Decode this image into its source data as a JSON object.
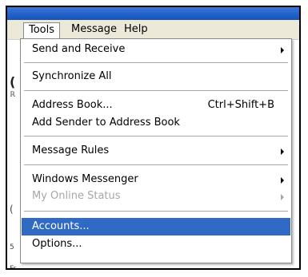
{
  "menubar": {
    "items": [
      {
        "label": "Tools"
      },
      {
        "label": "Message"
      },
      {
        "label": "Help"
      }
    ]
  },
  "background_glyphs": {
    "g1": "(",
    "g2": "ℝ",
    "g3": "(",
    "g4": "5",
    "g5": "Fr"
  },
  "tools_menu": {
    "items": [
      {
        "label": "Send and Receive",
        "submenu": true
      },
      {
        "label": "Synchronize All"
      },
      {
        "label": "Address Book...",
        "shortcut": "Ctrl+Shift+B"
      },
      {
        "label": "Add Sender to Address Book"
      },
      {
        "label": "Message Rules",
        "submenu": true
      },
      {
        "label": "Windows Messenger",
        "submenu": true
      },
      {
        "label": "My Online Status",
        "submenu": true,
        "disabled": true
      },
      {
        "label": "Accounts...",
        "selected": true
      },
      {
        "label": "Options..."
      }
    ]
  },
  "colors": {
    "titlebar": "#1f5fc8",
    "menubar": "#ece9d8",
    "highlight": "#316ac5",
    "disabled_text": "#a7a6aa"
  }
}
